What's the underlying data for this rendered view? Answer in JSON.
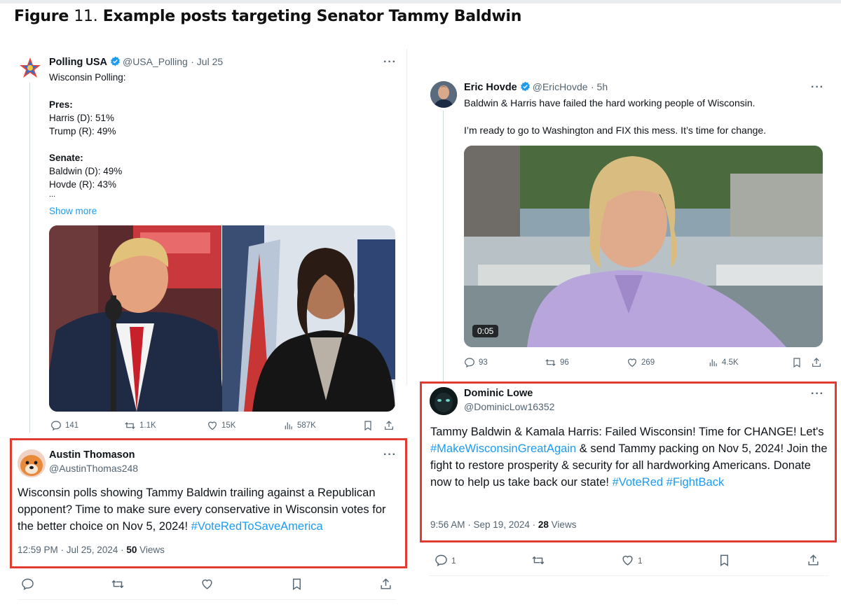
{
  "figure": {
    "label": "Figure",
    "number": "11.",
    "caption": "Example posts targeting Senator Tammy Baldwin"
  },
  "colors": {
    "link": "#1d9bf0",
    "highlight_border": "#e03c31",
    "muted": "#536471",
    "text": "#0f1419"
  },
  "posts": {
    "polling_usa": {
      "name": "Polling USA",
      "handle": "@USA_Polling",
      "date": "· Jul 25",
      "lines": [
        "Wisconsin Polling:",
        "Pres:",
        "Harris (D): 51%",
        "Trump (R): 49%",
        "Senate:",
        "Baldwin (D): 49%",
        "Hovde (R): 43%",
        "..."
      ],
      "show_more": "Show more",
      "stats": {
        "replies": "141",
        "reposts": "1.1K",
        "likes": "15K",
        "views": "587K"
      }
    },
    "austin": {
      "name": "Austin Thomason",
      "handle": "@AustinThomas248",
      "text": "Wisconsin polls showing Tammy Baldwin trailing against a Republican opponent? Time to make sure every conservative in Wisconsin votes for the better choice on Nov 5, 2024!",
      "hashtag": "#VoteRedToSaveAmerica",
      "time": "12:59 PM · Jul 25, 2024 ·",
      "views_count": "50",
      "views_label": "Views"
    },
    "eric": {
      "name": "Eric Hovde",
      "handle": "@EricHovde",
      "date": "· 5h",
      "line1": "Baldwin & Harris have failed the hard working people of Wisconsin.",
      "line2": "I’m ready to go to Washington and FIX this mess. It’s time for change.",
      "video_time": "0:05",
      "stats": {
        "replies": "93",
        "reposts": "96",
        "likes": "269",
        "views": "4.5K"
      }
    },
    "dominic": {
      "name": "Dominic Lowe",
      "handle": "@DominicLow16352",
      "text_a": "Tammy Baldwin & Kamala Harris: Failed Wisconsin! Time for CHANGE! Let's",
      "hashtag1": "#MakeWisconsinGreatAgain",
      "text_b": "& send Tammy packing on Nov 5, 2024! Join the fight to restore prosperity & security for all hardworking Americans. Donate now to help us take back our state!",
      "hashtag2": "#VoteRed",
      "hashtag3": "#FightBack",
      "time": "9:56 AM · Sep 19, 2024 ·",
      "views_count": "28",
      "views_label": "Views",
      "stats": {
        "replies": "1",
        "likes": "1"
      }
    }
  },
  "more_glyph": "···"
}
